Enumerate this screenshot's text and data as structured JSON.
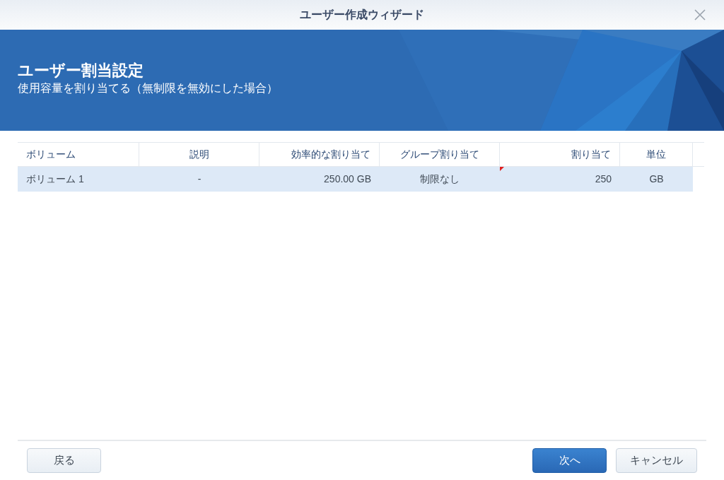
{
  "window": {
    "title": "ユーザー作成ウィザード"
  },
  "banner": {
    "title": "ユーザー割当設定",
    "subtitle": "使用容量を割り当てる（無制限を無効にした場合）"
  },
  "table": {
    "columns": [
      "ボリューム",
      "説明",
      "効率的な割り当て",
      "グループ割り当て",
      "割り当て",
      "単位"
    ],
    "rows": [
      {
        "selected": true,
        "cells": [
          {
            "text": "ボリューム 1",
            "modified": false
          },
          {
            "text": "-",
            "modified": false
          },
          {
            "text": "250.00 GB",
            "modified": false
          },
          {
            "text": "制限なし",
            "modified": false
          },
          {
            "text": "250",
            "modified": true
          },
          {
            "text": "GB",
            "modified": false
          }
        ]
      }
    ]
  },
  "footer": {
    "buttons": [
      {
        "label": "戻る",
        "kind": "secondary"
      },
      {
        "label": "次へ",
        "kind": "primary"
      },
      {
        "label": "キャンセル",
        "kind": "secondary"
      }
    ]
  }
}
